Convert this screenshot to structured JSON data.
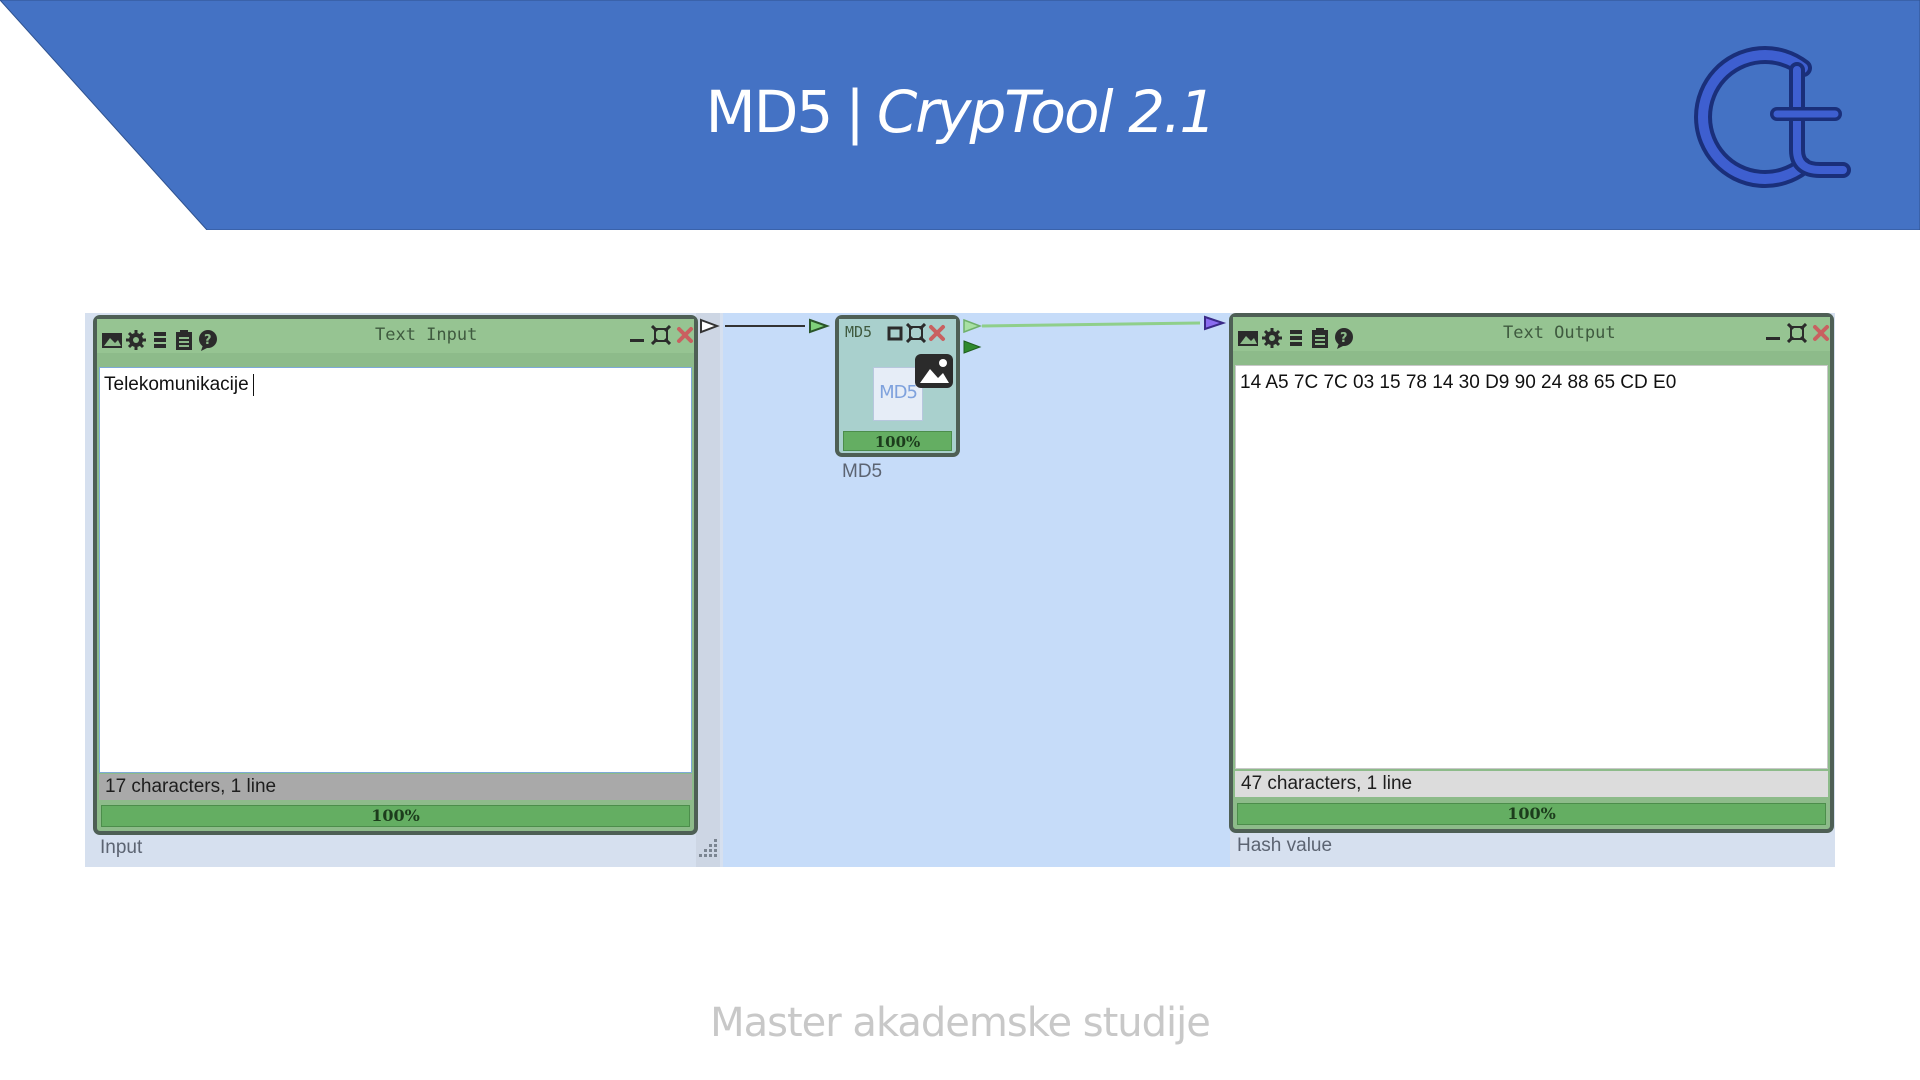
{
  "header": {
    "title": "MD5",
    "separator": "|",
    "subtitle": "CrypTool 2.1",
    "banner_color": "#4472c4",
    "logo_icon": "cryptool-ct-logo"
  },
  "workspace": {
    "canvas_color": "#c6dcf9",
    "text_input": {
      "title": "Text Input",
      "content": "Telekomunikacije",
      "status": "17 characters,  1 line",
      "progress": "100%",
      "caption": "Input",
      "toolbar_icons": [
        "presentation-icon",
        "settings-icon",
        "log-icon",
        "data-icon",
        "help-icon"
      ]
    },
    "md5": {
      "title": "MD5",
      "icon_label": "MD5",
      "progress": "100%",
      "caption": "MD5"
    },
    "text_output": {
      "title": "Text Output",
      "content": "14 A5 7C 7C 03 15 78 14 30 D9 90 24 88 65 CD E0",
      "status": "47 characters,  1 line",
      "progress": "100%",
      "caption": "Hash value",
      "toolbar_icons": [
        "presentation-icon",
        "settings-icon",
        "log-icon",
        "data-icon",
        "help-icon"
      ]
    }
  },
  "footer": {
    "text": "Master akademske studije"
  }
}
